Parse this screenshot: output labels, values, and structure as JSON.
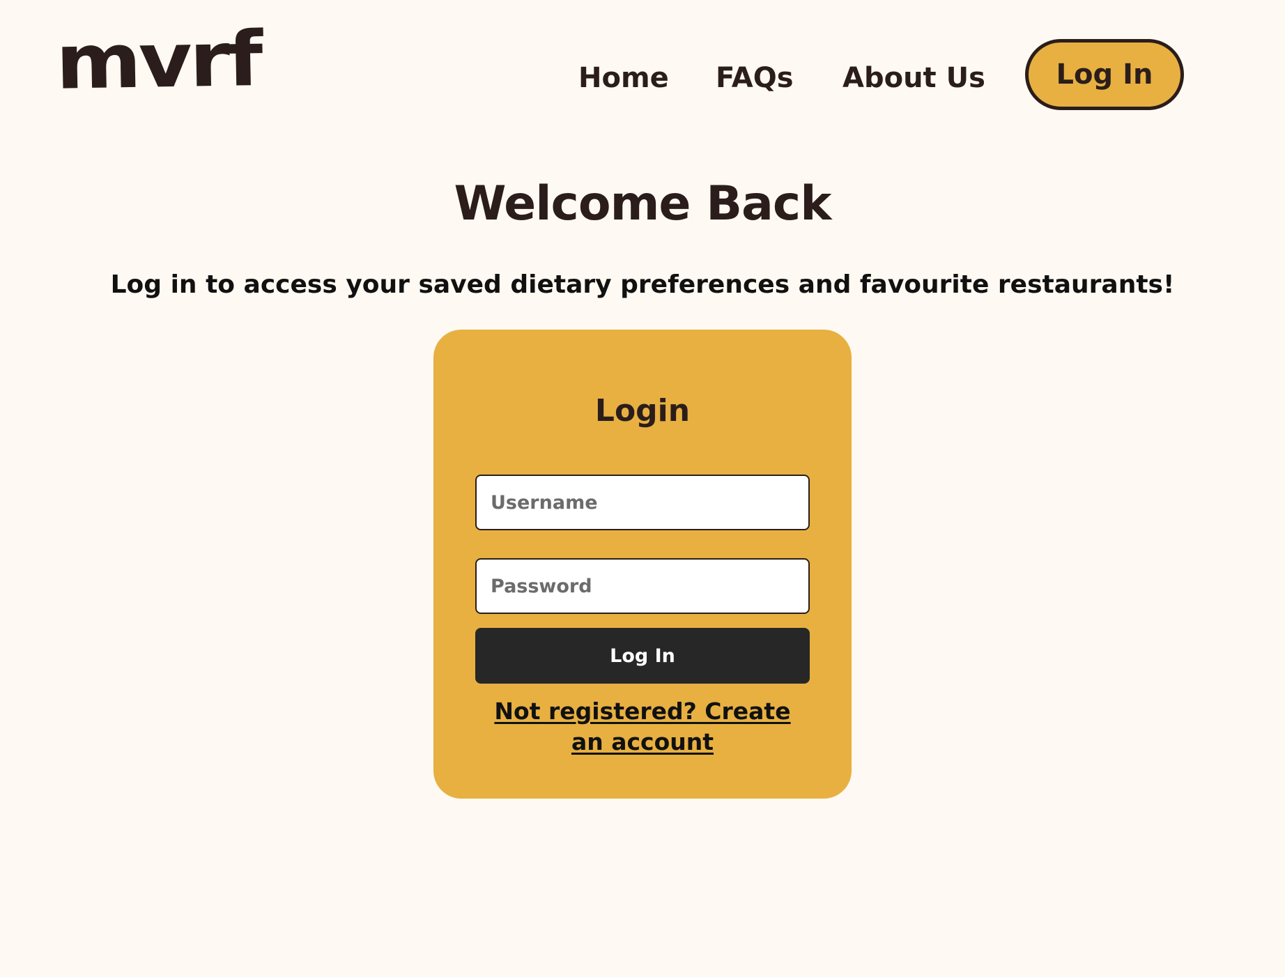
{
  "header": {
    "logo_text": "mvrf",
    "nav": {
      "home": "Home",
      "faqs": "FAQs",
      "about": "About Us",
      "login": "Log In"
    }
  },
  "main": {
    "title": "Welcome Back",
    "subtitle": "Log in to access your saved dietary preferences and favourite restaurants!"
  },
  "login_form": {
    "title": "Login",
    "username": {
      "value": "",
      "placeholder": "Username"
    },
    "password": {
      "value": "",
      "placeholder": "Password"
    },
    "submit_label": "Log In",
    "register_link": "Not registered? Create an account"
  },
  "colors": {
    "page_background": "#fef9f2",
    "accent": "#e7b041",
    "text_dark": "#2b1d1b",
    "button_dark": "#272727"
  }
}
